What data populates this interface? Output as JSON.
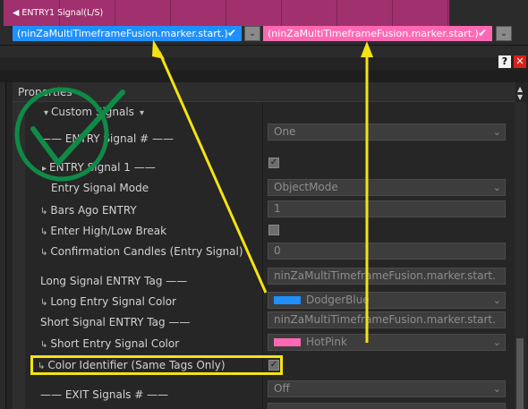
{
  "top": {
    "chart_label": "ENTRY1 Signal(L/S)",
    "long_tag_value": "(ninZaMultiTimeframeFusion.marker.start.)",
    "short_tag_value": "(ninZaMultiTimeframeFusion.marker.start.)",
    "long_color": "#1e90ff",
    "short_color": "#ff69b4",
    "chart_color": "#a0306e",
    "help_glyph": "?",
    "close_glyph": "✕"
  },
  "panel": {
    "title": "Properties",
    "rows": [
      {
        "label": "Custom Signals",
        "value": ""
      },
      {
        "label": "—— ENTRY Signal # ——",
        "value": "One"
      },
      {
        "label": "ENTRY Signal 1 ——",
        "value": "checked"
      },
      {
        "label": "Entry Signal Mode",
        "value": "ObjectMode"
      },
      {
        "label": "Bars Ago ENTRY",
        "value": "1"
      },
      {
        "label": "Enter High/Low Break",
        "value": "checked"
      },
      {
        "label": "Confirmation Candles (Entry Signal)",
        "value": "0"
      },
      {
        "label": "Long Signal ENTRY Tag ——",
        "value": "ninZaMultiTimeframeFusion.marker.start."
      },
      {
        "label": "Long Entry Signal Color",
        "value": "DodgerBlue"
      },
      {
        "label": "Short Signal ENTRY Tag ——",
        "value": "ninZaMultiTimeframeFusion.marker.start."
      },
      {
        "label": "Short Entry Signal Color",
        "value": "HotPink"
      },
      {
        "label": "Color Identifier (Same Tags Only)",
        "value": "checked"
      },
      {
        "label": "—— EXIT Signals # ——",
        "value": "Off"
      }
    ],
    "dodger_color": "#1e90ff",
    "hotpink_color": "#ff69b4"
  },
  "annotations": {
    "checkmark_color": "#0f8a47",
    "arrow_color": "#f4e312",
    "highlight_color": "#f4e312"
  }
}
